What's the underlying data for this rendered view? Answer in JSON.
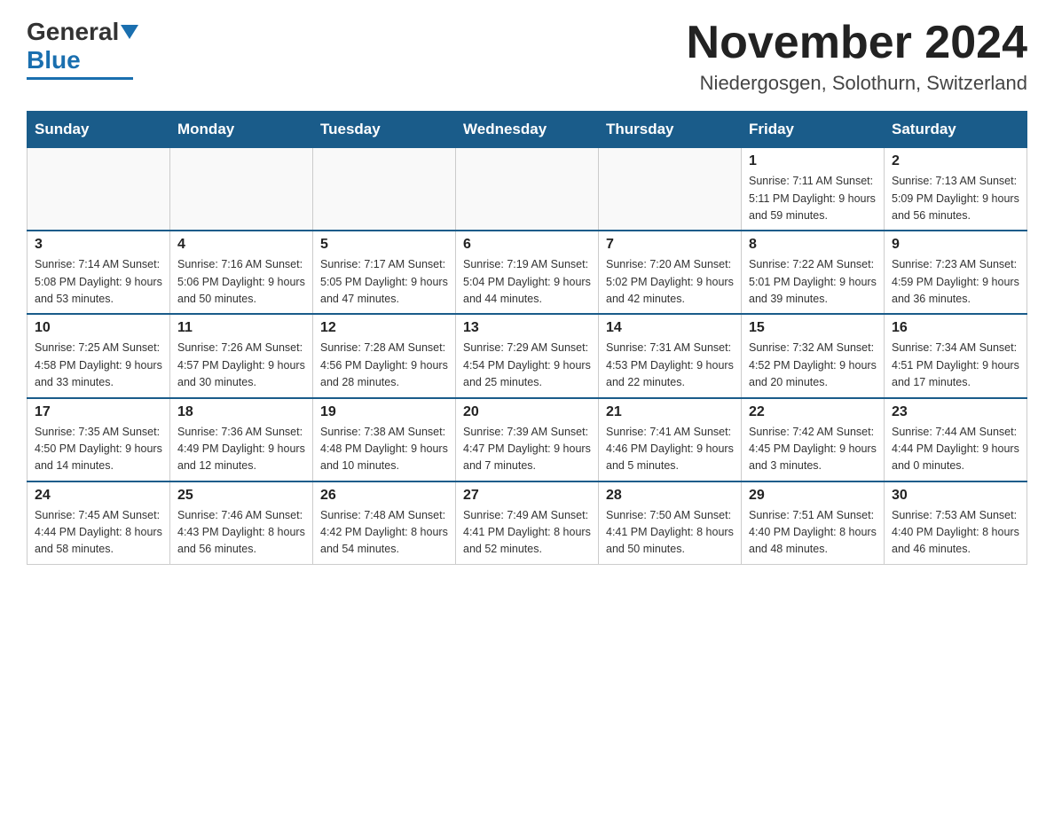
{
  "header": {
    "logo_general": "General",
    "logo_blue": "Blue",
    "month_title": "November 2024",
    "location": "Niedergosgen, Solothurn, Switzerland"
  },
  "days_of_week": [
    "Sunday",
    "Monday",
    "Tuesday",
    "Wednesday",
    "Thursday",
    "Friday",
    "Saturday"
  ],
  "weeks": [
    [
      {
        "day": "",
        "info": ""
      },
      {
        "day": "",
        "info": ""
      },
      {
        "day": "",
        "info": ""
      },
      {
        "day": "",
        "info": ""
      },
      {
        "day": "",
        "info": ""
      },
      {
        "day": "1",
        "info": "Sunrise: 7:11 AM\nSunset: 5:11 PM\nDaylight: 9 hours\nand 59 minutes."
      },
      {
        "day": "2",
        "info": "Sunrise: 7:13 AM\nSunset: 5:09 PM\nDaylight: 9 hours\nand 56 minutes."
      }
    ],
    [
      {
        "day": "3",
        "info": "Sunrise: 7:14 AM\nSunset: 5:08 PM\nDaylight: 9 hours\nand 53 minutes."
      },
      {
        "day": "4",
        "info": "Sunrise: 7:16 AM\nSunset: 5:06 PM\nDaylight: 9 hours\nand 50 minutes."
      },
      {
        "day": "5",
        "info": "Sunrise: 7:17 AM\nSunset: 5:05 PM\nDaylight: 9 hours\nand 47 minutes."
      },
      {
        "day": "6",
        "info": "Sunrise: 7:19 AM\nSunset: 5:04 PM\nDaylight: 9 hours\nand 44 minutes."
      },
      {
        "day": "7",
        "info": "Sunrise: 7:20 AM\nSunset: 5:02 PM\nDaylight: 9 hours\nand 42 minutes."
      },
      {
        "day": "8",
        "info": "Sunrise: 7:22 AM\nSunset: 5:01 PM\nDaylight: 9 hours\nand 39 minutes."
      },
      {
        "day": "9",
        "info": "Sunrise: 7:23 AM\nSunset: 4:59 PM\nDaylight: 9 hours\nand 36 minutes."
      }
    ],
    [
      {
        "day": "10",
        "info": "Sunrise: 7:25 AM\nSunset: 4:58 PM\nDaylight: 9 hours\nand 33 minutes."
      },
      {
        "day": "11",
        "info": "Sunrise: 7:26 AM\nSunset: 4:57 PM\nDaylight: 9 hours\nand 30 minutes."
      },
      {
        "day": "12",
        "info": "Sunrise: 7:28 AM\nSunset: 4:56 PM\nDaylight: 9 hours\nand 28 minutes."
      },
      {
        "day": "13",
        "info": "Sunrise: 7:29 AM\nSunset: 4:54 PM\nDaylight: 9 hours\nand 25 minutes."
      },
      {
        "day": "14",
        "info": "Sunrise: 7:31 AM\nSunset: 4:53 PM\nDaylight: 9 hours\nand 22 minutes."
      },
      {
        "day": "15",
        "info": "Sunrise: 7:32 AM\nSunset: 4:52 PM\nDaylight: 9 hours\nand 20 minutes."
      },
      {
        "day": "16",
        "info": "Sunrise: 7:34 AM\nSunset: 4:51 PM\nDaylight: 9 hours\nand 17 minutes."
      }
    ],
    [
      {
        "day": "17",
        "info": "Sunrise: 7:35 AM\nSunset: 4:50 PM\nDaylight: 9 hours\nand 14 minutes."
      },
      {
        "day": "18",
        "info": "Sunrise: 7:36 AM\nSunset: 4:49 PM\nDaylight: 9 hours\nand 12 minutes."
      },
      {
        "day": "19",
        "info": "Sunrise: 7:38 AM\nSunset: 4:48 PM\nDaylight: 9 hours\nand 10 minutes."
      },
      {
        "day": "20",
        "info": "Sunrise: 7:39 AM\nSunset: 4:47 PM\nDaylight: 9 hours\nand 7 minutes."
      },
      {
        "day": "21",
        "info": "Sunrise: 7:41 AM\nSunset: 4:46 PM\nDaylight: 9 hours\nand 5 minutes."
      },
      {
        "day": "22",
        "info": "Sunrise: 7:42 AM\nSunset: 4:45 PM\nDaylight: 9 hours\nand 3 minutes."
      },
      {
        "day": "23",
        "info": "Sunrise: 7:44 AM\nSunset: 4:44 PM\nDaylight: 9 hours\nand 0 minutes."
      }
    ],
    [
      {
        "day": "24",
        "info": "Sunrise: 7:45 AM\nSunset: 4:44 PM\nDaylight: 8 hours\nand 58 minutes."
      },
      {
        "day": "25",
        "info": "Sunrise: 7:46 AM\nSunset: 4:43 PM\nDaylight: 8 hours\nand 56 minutes."
      },
      {
        "day": "26",
        "info": "Sunrise: 7:48 AM\nSunset: 4:42 PM\nDaylight: 8 hours\nand 54 minutes."
      },
      {
        "day": "27",
        "info": "Sunrise: 7:49 AM\nSunset: 4:41 PM\nDaylight: 8 hours\nand 52 minutes."
      },
      {
        "day": "28",
        "info": "Sunrise: 7:50 AM\nSunset: 4:41 PM\nDaylight: 8 hours\nand 50 minutes."
      },
      {
        "day": "29",
        "info": "Sunrise: 7:51 AM\nSunset: 4:40 PM\nDaylight: 8 hours\nand 48 minutes."
      },
      {
        "day": "30",
        "info": "Sunrise: 7:53 AM\nSunset: 4:40 PM\nDaylight: 8 hours\nand 46 minutes."
      }
    ]
  ]
}
